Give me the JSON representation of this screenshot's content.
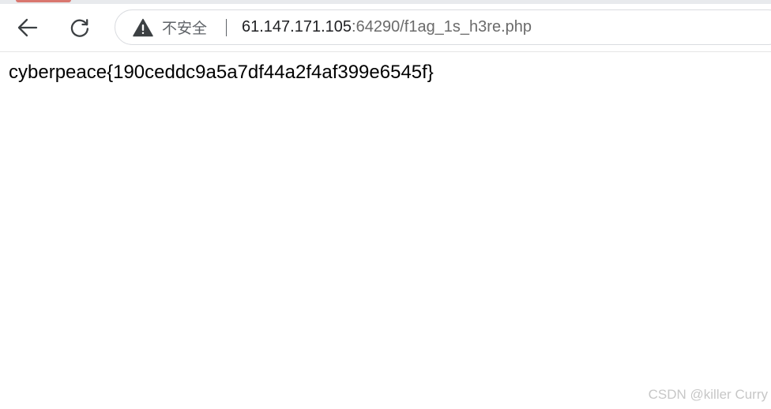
{
  "browser": {
    "security_label": "不安全",
    "url_host": "61.147.171.105",
    "url_rest": ":64290/f1ag_1s_h3re.php",
    "icons": {
      "back": "arrow-left-icon",
      "reload": "reload-icon",
      "security": "warning-icon"
    }
  },
  "page": {
    "content": "cyberpeace{190ceddc9a5a7df44a2f4af399e6545f}"
  },
  "watermark": "CSDN @killer Curry",
  "colors": {
    "tab_accent": "#d9776f",
    "icon": "#3c4043",
    "url_host": "#202124",
    "url_rest": "#6b6b6b",
    "watermark": "#c7c7c7"
  }
}
